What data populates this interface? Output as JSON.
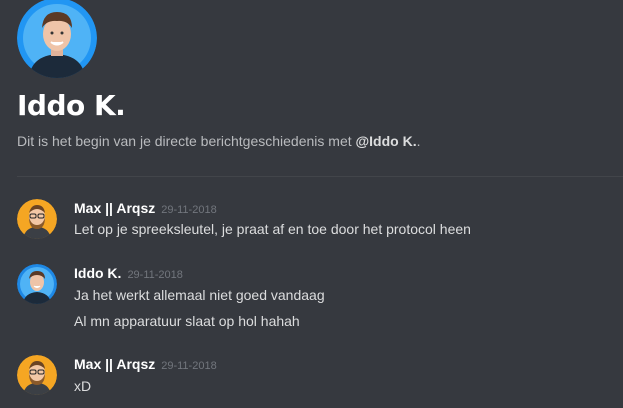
{
  "header": {
    "title": "Iddo K.",
    "intro_prefix": "Dit is het begin van je directe berichtgeschiedenis met ",
    "intro_user": "@Iddo K.",
    "intro_suffix": "."
  },
  "messages": [
    {
      "author": "Max || Arqsz",
      "timestamp": "29-11-2018",
      "lines": [
        "Let op je spreeksleutel, je praat af en toe door het protocol heen"
      ]
    },
    {
      "author": "Iddo K.",
      "timestamp": "29-11-2018",
      "lines": [
        "Ja het werkt allemaal niet goed vandaag",
        "Al mn apparatuur slaat op hol hahah"
      ]
    },
    {
      "author": "Max || Arqsz",
      "timestamp": "29-11-2018",
      "lines": [
        "xD"
      ]
    }
  ],
  "colors": {
    "background": "#36393f",
    "author": "#ffffff",
    "timestamp": "#72767d",
    "text": "#dcddde",
    "max_avatar_bg": "#f5a623",
    "iddo_avatar_bg": "#1e88e5"
  }
}
